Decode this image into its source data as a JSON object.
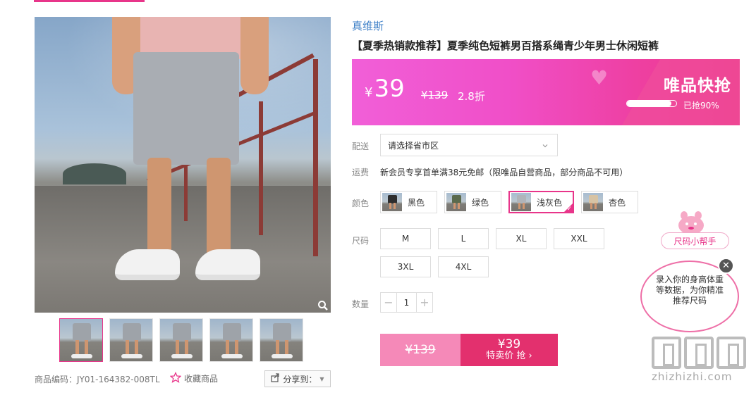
{
  "product": {
    "brand": "真维斯",
    "title": "【夏季热销款推荐】夏季纯色短裤男百搭系绳青少年男士休闲短裤",
    "sku_code": "商品编码：JY01-164382-008TL",
    "favorite_label": "收藏商品",
    "share_label": "分享到："
  },
  "price": {
    "currency": "¥",
    "current": "39",
    "original": "¥139",
    "discount": "2.8折",
    "flash_sale_logo": "唯品快抢",
    "sold_percent": 90,
    "sold_text": "已抢90%"
  },
  "delivery": {
    "label": "配送",
    "placeholder": "请选择省市区"
  },
  "shipping": {
    "label": "运费",
    "text": "新会员专享首单满38元免邮（限唯品自营商品，部分商品不可用）"
  },
  "colors": {
    "label": "颜色",
    "options": [
      "黑色",
      "绿色",
      "浅灰色",
      "杏色"
    ],
    "selected": "浅灰色",
    "swatch_colors": [
      "#2d2d2d",
      "#5b6a4d",
      "#b0b4b9",
      "#d7c3a4"
    ]
  },
  "sizes": {
    "label": "尺码",
    "options": [
      "M",
      "L",
      "XL",
      "XXL",
      "3XL",
      "4XL"
    ]
  },
  "quantity": {
    "label": "数量",
    "value": "1",
    "minus": "−",
    "plus": "+"
  },
  "buy": {
    "original_price": "¥139",
    "price": "¥39",
    "action": "特卖价 抢 ›"
  },
  "size_helper": {
    "label": "尺码小帮手",
    "text": "录入你的身高体重等数据，为你精准推荐尺码",
    "close": "✕"
  },
  "watermark": {
    "text": "zhizhizhi.com"
  },
  "colors_theme": {
    "accent": "#e8358a",
    "brand_link": "#3d7fc7",
    "buy_button": "#e3306e"
  }
}
